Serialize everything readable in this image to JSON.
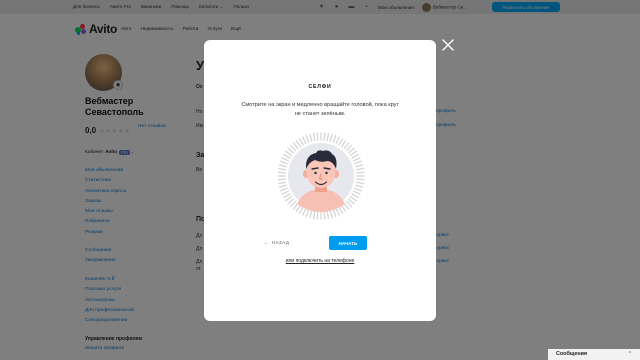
{
  "topbar": {
    "left_links": [
      "Для бизнеса",
      "Авито Pro",
      "Вакансии",
      "Помощь",
      "Каталоги",
      "Польза"
    ],
    "my_ads": "Мои объявления",
    "user_name": "Вебмастер Се...",
    "post_button": "Разместить объявление"
  },
  "header": {
    "logo": "Avito",
    "nav": [
      "Авто",
      "Недвижимость",
      "Работа",
      "Услуги",
      "Ещё"
    ]
  },
  "sidebar": {
    "name": "Вебмастер Севастополь",
    "rating": "0,0",
    "stars": "★★★★★",
    "no_reviews": "Нет отзывов",
    "cabinet_label": "Кабинет",
    "cabinet_brand": "Avito",
    "cabinet_pro": "Pro",
    "group1": [
      "Мои объявления",
      "Статистика",
      "Аналитика спроса",
      "Заказы",
      "Мои отзывы",
      "Избранное",
      "Резюме"
    ],
    "group2": [
      "Сообщения",
      "Уведомления"
    ],
    "group3": [
      "Кошелёк: 0 ₽",
      "Платные услуги",
      "Автозагрузка",
      "Для профессионалов",
      "Спецпредложения"
    ],
    "section_head": "Управление профилем",
    "section_link": "Защита профиля"
  },
  "background": {
    "page_title": "У",
    "tab": "Ос",
    "row1": "Но",
    "row2": "Им",
    "link1": "профиль",
    "link2": "профиль",
    "section1": "За",
    "section1_text": "Ве",
    "section2": "По",
    "row3": "Дл",
    "row4": "Дл",
    "row5": "Дл",
    "row5b": "от",
    "link3": "просервис",
    "link4": "просервис",
    "link5": "просервис"
  },
  "chat": {
    "label": "Сообщения"
  },
  "modal": {
    "title": "СЕЛФИ",
    "instruction": "Смотрите на экран и медленно вращайте головой, пока круг не станет зелёным.",
    "back_label": "НАЗАД",
    "start_button": "НАЧАТЬ",
    "phone_link": "или подключить на телефоне"
  },
  "colors": {
    "accent": "#009cf0",
    "link": "#0a7bd6",
    "overlay": "rgba(0,0,0,0.5)"
  },
  "icons": [
    "heart-icon",
    "bell-icon",
    "chat-icon",
    "cart-icon",
    "close-icon",
    "camera-icon",
    "arrow-left-icon",
    "chevron-down-icon"
  ]
}
